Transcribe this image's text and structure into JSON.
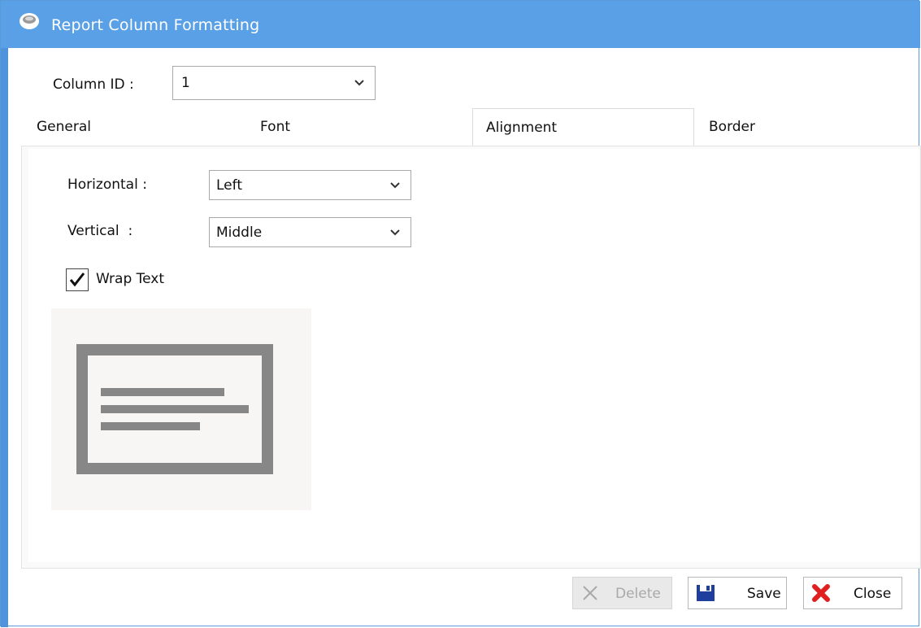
{
  "window": {
    "title": "Report Column Formatting"
  },
  "column_id": {
    "label": "Column ID :",
    "value": "1"
  },
  "tabs": [
    {
      "label": "General",
      "active": false
    },
    {
      "label": "Font",
      "active": false
    },
    {
      "label": "Alignment",
      "active": true
    },
    {
      "label": "Border",
      "active": false
    }
  ],
  "alignment": {
    "horizontal": {
      "label": "Horizontal :",
      "value": "Left"
    },
    "vertical": {
      "label": "Vertical  :",
      "value": "Middle"
    },
    "wrap_text": {
      "label": "Wrap Text",
      "checked": true
    },
    "preview_icon": "left-aligned-text-preview-icon"
  },
  "buttons": {
    "delete": {
      "label": "Delete",
      "enabled": false,
      "icon": "x-icon"
    },
    "save": {
      "label": "Save",
      "enabled": true,
      "icon": "floppy-disk-icon"
    },
    "close": {
      "label": "Close",
      "enabled": true,
      "icon": "red-x-icon"
    }
  },
  "colors": {
    "titlebar": "#5aa0e6",
    "accent": "#4f93da",
    "close_icon": "#e02020",
    "save_icon": "#1f3f9e"
  }
}
